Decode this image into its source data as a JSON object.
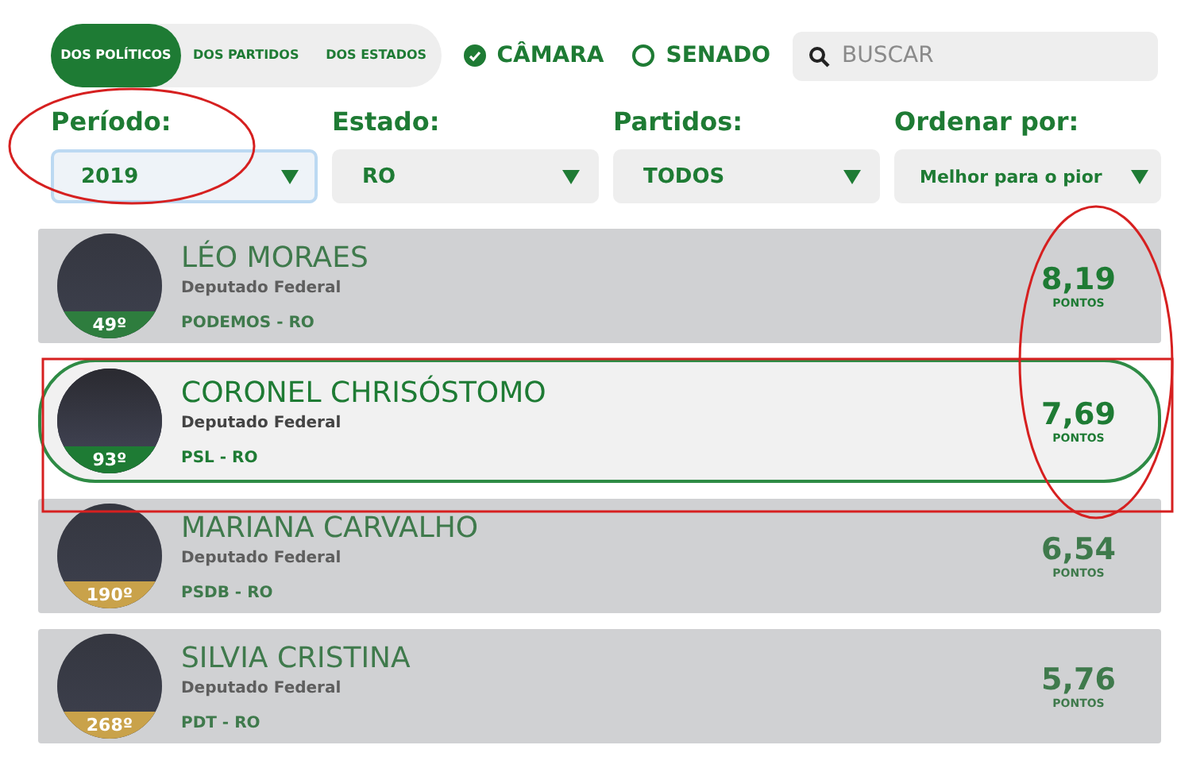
{
  "view_tabs": [
    {
      "label": "DOS POLÍTICOS",
      "selected": true
    },
    {
      "label": "DOS PARTIDOS",
      "selected": false
    },
    {
      "label": "DOS ESTADOS",
      "selected": false
    }
  ],
  "houses": [
    {
      "label": "CÂMARA",
      "selected": true
    },
    {
      "label": "SENADO",
      "selected": false
    }
  ],
  "search": {
    "placeholder": "BUSCAR"
  },
  "filters": [
    {
      "label": "Período:",
      "value": "2019",
      "focused": true
    },
    {
      "label": "Estado:",
      "value": "RO",
      "focused": false
    },
    {
      "label": "Partidos:",
      "value": "TODOS",
      "focused": false
    },
    {
      "label": "Ordenar por:",
      "value": "Melhor para o pior",
      "focused": false
    }
  ],
  "politicians": [
    {
      "name": "LÉO MORAES",
      "role": "Deputado Federal",
      "party": "PODEMOS - RO",
      "rank": "49º",
      "color": "#2e7d3e",
      "score": "8,19",
      "score_unit": "PONTOS",
      "dimmed": true,
      "highlighted": false
    },
    {
      "name": "CORONEL CHRISÓSTOMO",
      "role": "Deputado Federal",
      "party": "PSL - RO",
      "rank": "93º",
      "color": "#1e7b34",
      "score": "7,69",
      "score_unit": "PONTOS",
      "dimmed": false,
      "highlighted": true
    },
    {
      "name": "MARIANA CARVALHO",
      "role": "Deputado Federal",
      "party": "PSDB - RO",
      "rank": "190º",
      "color": "#c9a24a",
      "score": "6,54",
      "score_unit": "PONTOS",
      "dimmed": true,
      "highlighted": false
    },
    {
      "name": "SILVIA CRISTINA",
      "role": "Deputado Federal",
      "party": "PDT - RO",
      "rank": "268º",
      "color": "#c9a24a",
      "score": "5,76",
      "score_unit": "PONTOS",
      "dimmed": true,
      "highlighted": false
    }
  ]
}
